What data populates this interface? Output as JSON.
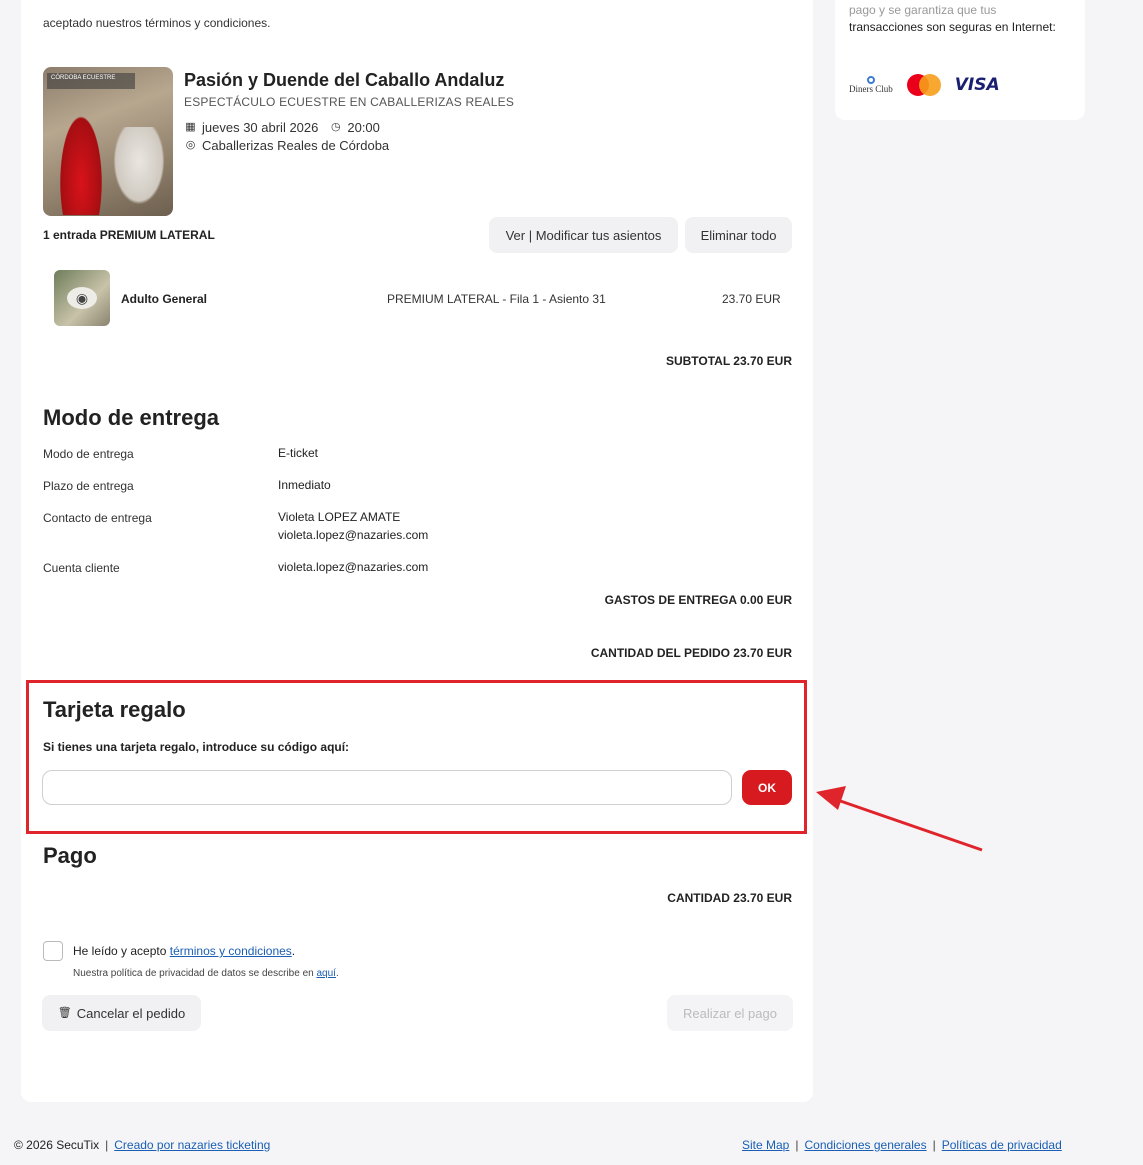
{
  "side": {
    "text_faded": "pago y se garantiza que tus",
    "text": "transacciones son seguras en Internet:",
    "logos": [
      "Diners Club",
      "mastercard",
      "VISA"
    ]
  },
  "top_note": "aceptado nuestros términos y condiciones.",
  "event": {
    "poster_banner": "CÓRDOBA ECUESTRE",
    "title": "Pasión y Duende del Caballo Andaluz",
    "subtitle": "ESPECTÁCULO ECUESTRE EN CABALLERIZAS REALES",
    "date": "jueves 30 abril 2026",
    "time": "20:00",
    "venue": "Caballerizas Reales de Córdoba"
  },
  "tickets": {
    "count_label": "1 entrada PREMIUM LATERAL",
    "view_modify_label": "Ver | Modificar tus asientos",
    "delete_all_label": "Eliminar todo",
    "items": [
      {
        "name": "Adulto General",
        "seat": "PREMIUM LATERAL - Fila 1 - Asiento 31",
        "price": "23.70 EUR"
      }
    ],
    "subtotal": "SUBTOTAL  23.70 EUR"
  },
  "delivery": {
    "title": "Modo de entrega",
    "rows": [
      {
        "key": "Modo de entrega",
        "value": "E-ticket"
      },
      {
        "key": "Plazo de entrega",
        "value": "Inmediato"
      },
      {
        "key": "Contacto de entrega",
        "value": "Violeta LOPEZ AMATE",
        "value2": "violeta.lopez@nazaries.com"
      },
      {
        "key": "Cuenta cliente",
        "value": "violeta.lopez@nazaries.com"
      }
    ],
    "shipping_cost": "GASTOS DE ENTREGA 0.00 EUR",
    "order_amount": "CANTIDAD DEL PEDIDO 23.70 EUR"
  },
  "gift_card": {
    "title": "Tarjeta regalo",
    "label": "Si tienes una tarjeta regalo, introduce su código aquí:",
    "input_value": "",
    "ok_label": "OK"
  },
  "payment": {
    "title": "Pago",
    "amount": "CANTIDAD 23.70 EUR",
    "terms_prefix": "He leído y acepto ",
    "terms_link": "términos y condiciones",
    "terms_suffix": ".",
    "privacy_prefix": "Nuestra política de privacidad de datos se describe en ",
    "privacy_link": "aquí",
    "privacy_suffix": ".",
    "cancel_label": "Cancelar el pedido",
    "pay_label": "Realizar el pago",
    "terms_checked": false
  },
  "footer": {
    "copyright": "© 2026 SecuTix",
    "created_by": "Creado por nazaries ticketing",
    "site_map": "Site Map",
    "conditions": "Condiciones generales",
    "privacy": "Políticas de privacidad"
  },
  "colors": {
    "accent": "#d71920",
    "highlight_border": "#e0242b",
    "link": "#1a5fb4"
  }
}
